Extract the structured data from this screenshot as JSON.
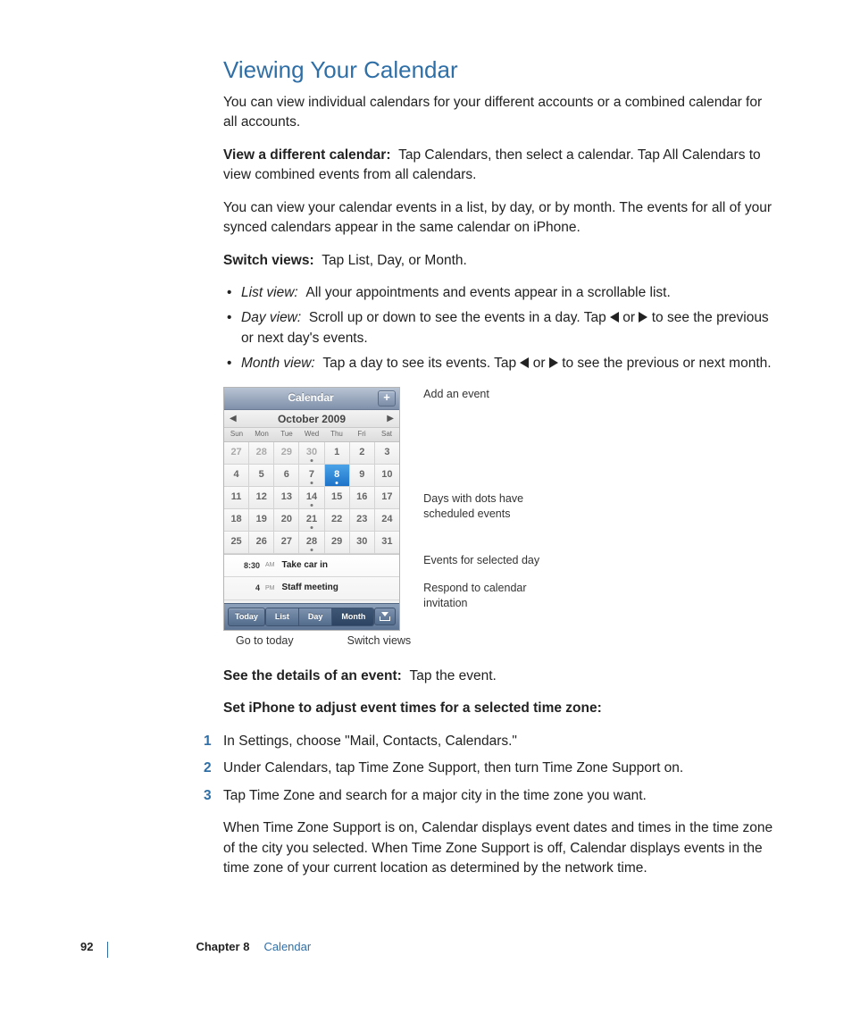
{
  "heading": "Viewing Your Calendar",
  "p1": "You can view individual calendars for your different accounts or a combined calendar for all accounts.",
  "p2_label": "View a different calendar:",
  "p2_body": "Tap Calendars, then select a calendar. Tap All Calendars to view combined events from all calendars.",
  "p3": "You can view your calendar events in a list, by day, or by month. The events for all of your synced calendars appear in the same calendar on iPhone.",
  "p4_label": "Switch views:",
  "p4_body": "Tap List, Day, or Month.",
  "bullets": {
    "b1_label": "List view:",
    "b1_body": "All your appointments and events appear in a scrollable list.",
    "b2_label": "Day view:",
    "b2_body_a": "Scroll up or down to see the events in a day. Tap ",
    "b2_body_b": " or ",
    "b2_body_c": " to see the previous or next day's events.",
    "b3_label": "Month view:",
    "b3_body_a": "Tap a day to see its events. Tap ",
    "b3_body_b": " or ",
    "b3_body_c": " to see the previous or next month."
  },
  "callouts": {
    "add": "Add an event",
    "dots": "Days with dots have scheduled events",
    "events": "Events for selected day",
    "respond": "Respond to calendar invitation",
    "today": "Go to today",
    "switch": "Switch views"
  },
  "phone": {
    "title": "Calendar",
    "plus": "+",
    "month": "October 2009",
    "dow": [
      "Sun",
      "Mon",
      "Tue",
      "Wed",
      "Thu",
      "Fri",
      "Sat"
    ],
    "weeks": [
      [
        {
          "n": "27",
          "dim": true
        },
        {
          "n": "28",
          "dim": true
        },
        {
          "n": "29",
          "dim": true
        },
        {
          "n": "30",
          "dim": true,
          "dot": true
        },
        {
          "n": "1"
        },
        {
          "n": "2"
        },
        {
          "n": "3"
        }
      ],
      [
        {
          "n": "4"
        },
        {
          "n": "5"
        },
        {
          "n": "6"
        },
        {
          "n": "7",
          "dot": true
        },
        {
          "n": "8",
          "sel": true,
          "dot": true
        },
        {
          "n": "9"
        },
        {
          "n": "10"
        }
      ],
      [
        {
          "n": "11"
        },
        {
          "n": "12"
        },
        {
          "n": "13"
        },
        {
          "n": "14",
          "dot": true
        },
        {
          "n": "15"
        },
        {
          "n": "16"
        },
        {
          "n": "17"
        }
      ],
      [
        {
          "n": "18"
        },
        {
          "n": "19"
        },
        {
          "n": "20"
        },
        {
          "n": "21",
          "dot": true
        },
        {
          "n": "22"
        },
        {
          "n": "23"
        },
        {
          "n": "24"
        }
      ],
      [
        {
          "n": "25"
        },
        {
          "n": "26"
        },
        {
          "n": "27"
        },
        {
          "n": "28",
          "dot": true
        },
        {
          "n": "29"
        },
        {
          "n": "30"
        },
        {
          "n": "31"
        }
      ]
    ],
    "events": [
      {
        "time": "8:30",
        "ampm": "AM",
        "name": "Take car in"
      },
      {
        "time": "4",
        "ampm": "PM",
        "name": "Staff meeting"
      }
    ],
    "toolbar": {
      "today": "Today",
      "list": "List",
      "day": "Day",
      "month": "Month"
    }
  },
  "p5_label": "See the details of an event:",
  "p5_body": "Tap the event.",
  "steps_heading": "Set iPhone to adjust event times for a selected time zone:",
  "steps": [
    "In Settings, choose \"Mail, Contacts, Calendars.\"",
    "Under Calendars, tap Time Zone Support, then turn Time Zone Support on.",
    "Tap Time Zone and search for a major city in the time zone you want."
  ],
  "p6": "When Time Zone Support is on, Calendar displays event dates and times in the time zone of the city you selected. When Time Zone Support is off, Calendar displays events in the time zone of your current location as determined by the network time.",
  "footer": {
    "page": "92",
    "chapter": "Chapter 8",
    "name": "Calendar"
  }
}
